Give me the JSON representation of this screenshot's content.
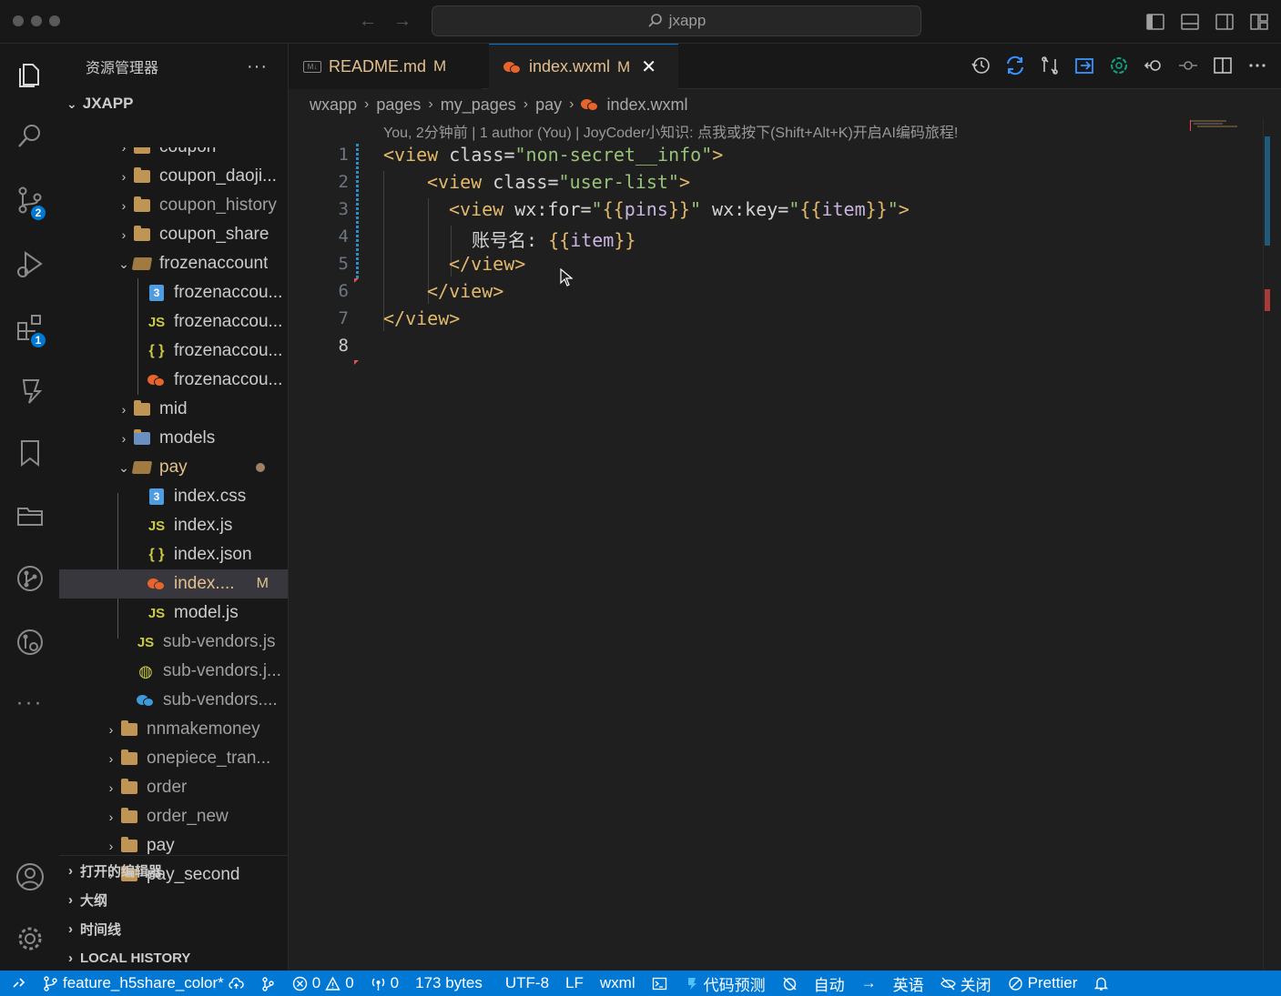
{
  "titlebar": {
    "search_text": "jxapp"
  },
  "activity": {
    "scm_badge": "2",
    "extensions_badge": "1"
  },
  "sidebar": {
    "title": "资源管理器",
    "more": "···",
    "root": "JXAPP",
    "items": [
      {
        "label": "coupon"
      },
      {
        "label": "coupon_daoji..."
      },
      {
        "label": "coupon_history"
      },
      {
        "label": "coupon_share"
      },
      {
        "label": "frozenaccount"
      },
      {
        "label": "frozenaccou..."
      },
      {
        "label": "frozenaccou..."
      },
      {
        "label": "frozenaccou..."
      },
      {
        "label": "frozenaccou..."
      },
      {
        "label": "mid"
      },
      {
        "label": "models"
      },
      {
        "label": "pay"
      },
      {
        "label": "index.css"
      },
      {
        "label": "index.js"
      },
      {
        "label": "index.json"
      },
      {
        "label": "index....",
        "mark": "M"
      },
      {
        "label": "model.js"
      },
      {
        "label": "sub-vendors.js"
      },
      {
        "label": "sub-vendors.j..."
      },
      {
        "label": "sub-vendors...."
      },
      {
        "label": "nnmakemoney"
      },
      {
        "label": "onepiece_tran..."
      },
      {
        "label": "order"
      },
      {
        "label": "order_new"
      },
      {
        "label": "pay"
      },
      {
        "label": "pay_second"
      }
    ],
    "sections": [
      "打开的编辑器",
      "大纲",
      "时间线",
      "LOCAL HISTORY"
    ]
  },
  "tabs": [
    {
      "label": "README.md",
      "mark": "M"
    },
    {
      "label": "index.wxml",
      "mark": "M",
      "close": "✕"
    }
  ],
  "breadcrumb": [
    "wxapp",
    "pages",
    "my_pages",
    "pay",
    "index.wxml"
  ],
  "editor": {
    "codelens": "You, 2分钟前 | 1 author (You) | JoyCoder小知识: 点我或按下(Shift+Alt+K)开启AI编码旅程!",
    "line_numbers": [
      "1",
      "2",
      "3",
      "4",
      "5",
      "6",
      "7",
      "8"
    ],
    "lines": {
      "l1": {
        "open": "<view",
        "attr": " class=",
        "str": "\"non-secret__info\"",
        "close": ">"
      },
      "l2": {
        "open": "<view",
        "attr": " class=",
        "str": "\"user-list\"",
        "close": ">"
      },
      "l3": {
        "open": "<view",
        "attr1": " wx:for=",
        "q1": "\"",
        "br1": "{{",
        "v1": "pins",
        "br2": "}}",
        "q2": "\"",
        "attr2": " wx:key=",
        "q3": "\"",
        "br3": "{{",
        "v2": "item",
        "br4": "}}",
        "q4": "\"",
        "close": ">"
      },
      "l4": {
        "text": "账号名: ",
        "br1": "{{",
        "v": "item",
        "br2": "}}"
      },
      "l5": {
        "tag": "</view>"
      },
      "l6": {
        "tag": "</view>"
      },
      "l7": {
        "tag": "</view>"
      }
    }
  },
  "statusbar": {
    "branch": "feature_h5share_color*",
    "errors": "0",
    "warnings": "0",
    "ports": "0",
    "size": "173 bytes",
    "encoding": "UTF-8",
    "eol": "LF",
    "language": "wxml",
    "predict": "代码预测",
    "auto": "自动",
    "lang_en": "英语",
    "close": "关闭",
    "prettier": "Prettier"
  },
  "colors": {
    "accent": "#0078d4",
    "modified": "#e2c08d",
    "tag": "#e2b86b",
    "string": "#98c379"
  }
}
